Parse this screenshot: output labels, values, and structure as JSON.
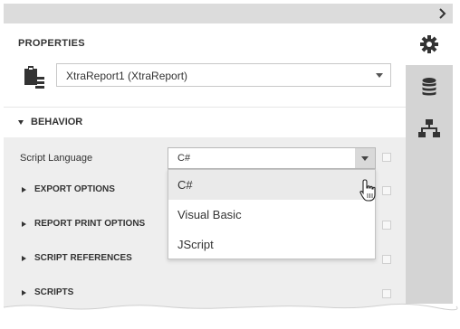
{
  "panel": {
    "title": "PROPERTIES",
    "report_selector": {
      "value": "XtraReport1 (XtraReport)"
    },
    "side_tabs": [
      {
        "icon": "gear-icon",
        "active": true
      },
      {
        "icon": "database-icon",
        "active": false
      },
      {
        "icon": "hierarchy-icon",
        "active": false
      }
    ]
  },
  "behavior": {
    "header": "BEHAVIOR",
    "script_language": {
      "label": "Script Language",
      "value": "C#",
      "options": [
        "C#",
        "Visual Basic",
        "JScript"
      ],
      "highlighted_option": "C#"
    }
  },
  "categories": [
    {
      "label": "EXPORT OPTIONS"
    },
    {
      "label": "REPORT PRINT OPTIONS"
    },
    {
      "label": "SCRIPT REFERENCES"
    },
    {
      "label": "SCRIPTS"
    }
  ],
  "colors": {
    "panel_bg": "#ffffff",
    "grid_bg": "#eeeeee",
    "side_bar": "#d4d4d4",
    "selected_item": "#eaeaea"
  }
}
